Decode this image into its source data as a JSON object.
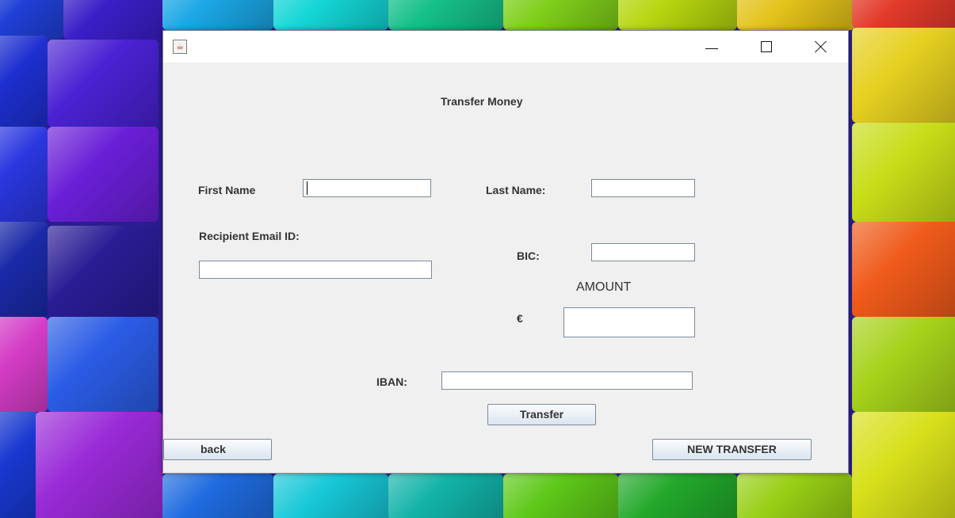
{
  "window": {
    "title": "",
    "app_icon": "java-coffee-cup-icon",
    "controls": {
      "minimize": "minimize-icon",
      "maximize": "maximize-icon",
      "close": "close-icon"
    }
  },
  "form": {
    "heading": "Transfer Money",
    "first_name": {
      "label": "First Name",
      "value": ""
    },
    "last_name": {
      "label": "Last Name:",
      "value": ""
    },
    "recipient_email": {
      "label": "Recipient Email ID:",
      "value": ""
    },
    "bic": {
      "label": "BIC:",
      "value": ""
    },
    "amount": {
      "label": "AMOUNT",
      "currency": "€",
      "value": ""
    },
    "iban": {
      "label": "IBAN:",
      "value": ""
    }
  },
  "buttons": {
    "transfer": "Transfer",
    "back": "back",
    "new_transfer": "NEW TRANSFER"
  }
}
